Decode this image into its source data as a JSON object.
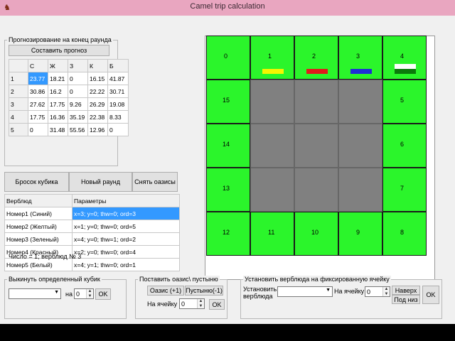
{
  "window": {
    "title": "Camel trip calculation",
    "app_icon": "camel-icon"
  },
  "forecast": {
    "group_label": "Прогнозирование на конец раунда",
    "make_button": "Составить прогноз",
    "headers": [
      "",
      "С",
      "Ж",
      "З",
      "К",
      "Б"
    ],
    "rows": [
      [
        "1",
        "23.77",
        "18.21",
        "0",
        "16.15",
        "41.87"
      ],
      [
        "2",
        "30.86",
        "16.2",
        "0",
        "22.22",
        "30.71"
      ],
      [
        "3",
        "27.62",
        "17.75",
        "9.26",
        "26.29",
        "19.08"
      ],
      [
        "4",
        "17.75",
        "16.36",
        "35.19",
        "22.38",
        "8.33"
      ],
      [
        "5",
        "0",
        "31.48",
        "55.56",
        "12.96",
        "0"
      ]
    ]
  },
  "actions": {
    "roll": "Бросок кубика",
    "new_round": "Новый раунд",
    "remove_oases": "Снять оазисы"
  },
  "camels": {
    "headers": [
      "Верблюд",
      "Параметры"
    ],
    "rows": [
      [
        "Номер1 (Синий)",
        "x=3; y=0; thw=0; ord=3"
      ],
      [
        "Номер2 (Желтый)",
        "x=1; y=0; thw=0; ord=5"
      ],
      [
        "Номер3 (Зеленый)",
        "x=4; y=0; thw=1; ord=2"
      ],
      [
        "Номер4 (Красный)",
        "x=2; y=0; thw=0; ord=4"
      ],
      [
        "Номер5 (Белый)",
        "x=4; y=1; thw=0; ord=1"
      ]
    ]
  },
  "status_text": "Число = 1; верблюд № 3",
  "board": {
    "top_labels": [
      "0",
      "1",
      "2",
      "3",
      "4"
    ],
    "right_labels": [
      "5",
      "6",
      "7"
    ],
    "bottom_labels": [
      "8",
      "9",
      "10",
      "11",
      "12"
    ],
    "left_labels": [
      "15",
      "14",
      "13"
    ],
    "camel_colors": {
      "yellow": "#f5f500",
      "red": "#e01b1b",
      "blue": "#1f2fd6",
      "white": "#ffffff",
      "green": "#0b7a0b"
    }
  },
  "dice": {
    "group_label": "Выкинуть определенный кубик",
    "na_label": "на",
    "value": "0",
    "ok": "OK"
  },
  "oasis": {
    "group_label": "Поставить оазис\\ пустыню",
    "oasis_button": "Оазис (+1)",
    "desert_button": "Пустыню(-1)",
    "cell_label": "На ячейку",
    "value": "0",
    "ok": "OK"
  },
  "setcamel": {
    "group_label": "Установить верблюда на фиксированную ячейку",
    "set_label_1": "Установить",
    "set_label_2": "верблюда",
    "cell_label": "На ячейку",
    "value": "0",
    "top_label": "Наверх",
    "bottom_label": "Под низ",
    "ok": "OK"
  }
}
